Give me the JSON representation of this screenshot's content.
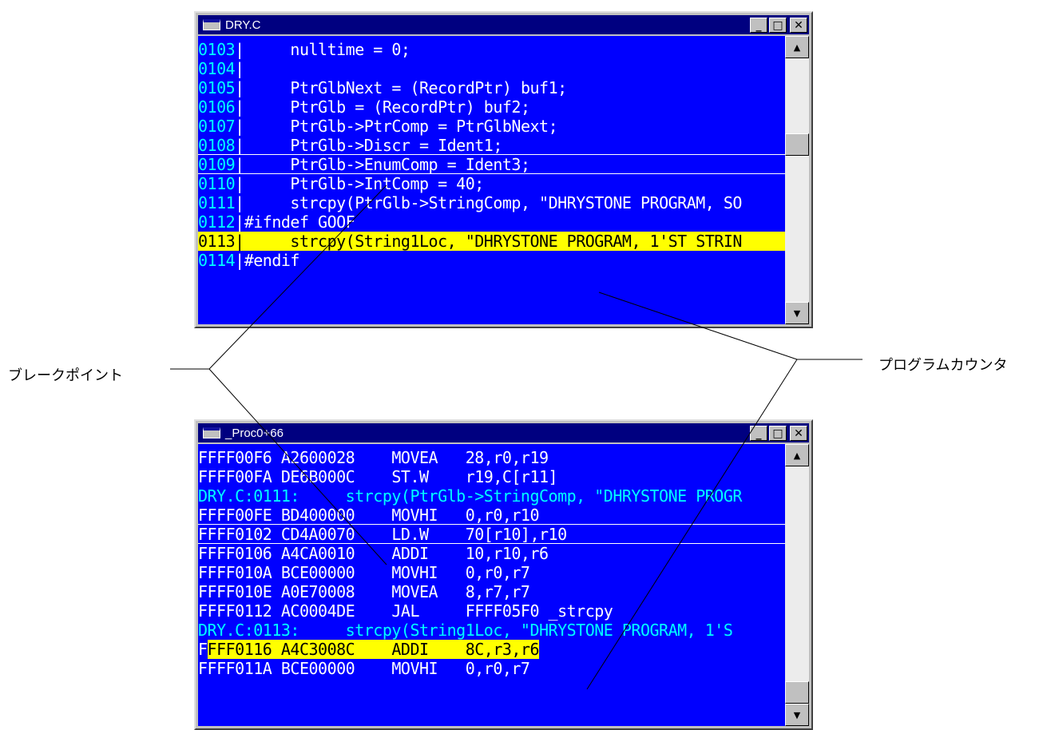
{
  "source_window": {
    "title": "DRY.C",
    "lines": [
      {
        "num": "0103",
        "code": "     nulltime = 0;"
      },
      {
        "num": "0104",
        "code": ""
      },
      {
        "num": "0105",
        "code": "     PtrGlbNext = (RecordPtr) buf1;"
      },
      {
        "num": "0106",
        "code": "     PtrGlb = (RecordPtr) buf2;"
      },
      {
        "num": "0107",
        "code": "     PtrGlb->PtrComp = PtrGlbNext;"
      },
      {
        "num": "0108",
        "code": "     PtrGlb->Discr = Ident1;"
      },
      {
        "num": "0109",
        "code": "     PtrGlb->EnumComp = Ident3;"
      },
      {
        "num": "0110",
        "code": "     PtrGlb->IntComp = 40;"
      },
      {
        "num": "0111",
        "code": "     strcpy(PtrGlb->StringComp, \"DHRYSTONE PROGRAM, SO"
      },
      {
        "num": "0112",
        "code": "#ifndef GOOF"
      },
      {
        "num": "0113",
        "code": "     strcpy(String1Loc, \"DHRYSTONE PROGRAM, 1'ST STRIN"
      },
      {
        "num": "0114",
        "code": "#endif"
      }
    ]
  },
  "disasm_window": {
    "title": "_Proc0+66",
    "lines": [
      {
        "text": "FFFF00F6 A2600028    MOVEA   28,r0,r19"
      },
      {
        "text": "FFFF00FA DE6B000C    ST.W    r19,C[r11]"
      },
      {
        "text": "DRY.C:0111:     strcpy(PtrGlb->StringComp, \"DHRYSTONE PROGR"
      },
      {
        "text": "FFFF00FE BD400000    MOVHI   0,r0,r10"
      },
      {
        "text": "FFFF0102 CD4A0070    LD.W    70[r10],r10"
      },
      {
        "text": "FFFF0106 A4CA0010    ADDI    10,r10,r6"
      },
      {
        "text": "FFFF010A BCE00000    MOVHI   0,r0,r7"
      },
      {
        "text": "FFFF010E A0E70008    MOVEA   8,r7,r7"
      },
      {
        "text": "FFFF0112 AC0004DE    JAL     FFFF05F0 _strcpy"
      },
      {
        "text": "DRY.C:0113:     strcpy(String1Loc, \"DHRYSTONE PROGRAM, 1'S"
      },
      {
        "pre": "F",
        "text": "FFF0116 A4C3008C    ADDI    8C,r3,r6"
      },
      {
        "text": "FFFF011A BCE00000    MOVHI   0,r0,r7"
      }
    ]
  },
  "callouts": {
    "breakpoint": "ブレークポイント",
    "program_counter": "プログラムカウンタ"
  },
  "colors": {
    "pane_bg": "#0000ff",
    "text": "#ffffff",
    "source_label": "#00ffff",
    "highlight": "#ffff00",
    "titlebar": "#000080"
  }
}
